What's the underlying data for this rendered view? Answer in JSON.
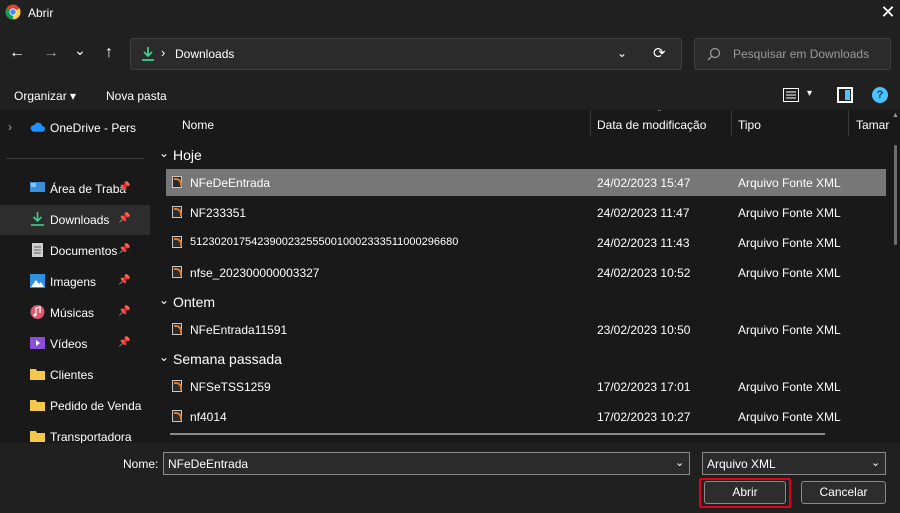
{
  "window": {
    "title": "Abrir",
    "close_glyph": "✕"
  },
  "nav": {
    "back_glyph": "←",
    "forward_glyph": "→",
    "recent_glyph": "⌄",
    "up_glyph": "↑",
    "address": "Downloads",
    "address_chevron": "›",
    "address_dropdown": "⌄",
    "refresh_glyph": "⟳",
    "search_placeholder": "Pesquisar em Downloads"
  },
  "toolbar": {
    "organize": "Organizar ▾",
    "new_folder": "Nova pasta",
    "view_dropdown": "▾",
    "help": "?"
  },
  "sidebar": {
    "onedrive": {
      "label": "OneDrive - Pers",
      "chevron": "›"
    },
    "items": [
      {
        "label": "Área de Traba",
        "icon": "desktop-icon",
        "pin": "📌"
      },
      {
        "label": "Downloads",
        "icon": "download-icon",
        "pin": "📌"
      },
      {
        "label": "Documentos",
        "icon": "documents-icon",
        "pin": "📌"
      },
      {
        "label": "Imagens",
        "icon": "pictures-icon",
        "pin": "📌"
      },
      {
        "label": "Músicas",
        "icon": "music-icon",
        "pin": "📌"
      },
      {
        "label": "Vídeos",
        "icon": "videos-icon",
        "pin": "📌"
      },
      {
        "label": "Clientes",
        "icon": "folder-icon",
        "pin": ""
      },
      {
        "label": "Pedido de Venda",
        "icon": "folder-icon",
        "pin": ""
      },
      {
        "label": "Transportadora",
        "icon": "folder-icon",
        "pin": ""
      }
    ]
  },
  "columns": {
    "name": "Nome",
    "date": "Data de modificação",
    "type": "Tipo",
    "size": "Tamar"
  },
  "groups": [
    {
      "label": "Hoje",
      "files": [
        {
          "name": "NFeDeEntrada",
          "date": "24/02/2023 15:47",
          "type": "Arquivo Fonte XML"
        },
        {
          "name": "NF233351",
          "date": "24/02/2023 11:47",
          "type": "Arquivo Fonte XML"
        },
        {
          "name": "51230201754239002325550010002333511000296680",
          "date": "24/02/2023 11:43",
          "type": "Arquivo Fonte XML"
        },
        {
          "name": "nfse_202300000003327",
          "date": "24/02/2023 10:52",
          "type": "Arquivo Fonte XML"
        }
      ]
    },
    {
      "label": "Ontem",
      "files": [
        {
          "name": "NFeEntrada11591",
          "date": "23/02/2023 10:50",
          "type": "Arquivo Fonte XML"
        }
      ]
    },
    {
      "label": "Semana passada",
      "files": [
        {
          "name": "NFSeTSS1259",
          "date": "17/02/2023 17:01",
          "type": "Arquivo Fonte XML"
        },
        {
          "name": "nf4014",
          "date": "17/02/2023 10:27",
          "type": "Arquivo Fonte XML"
        }
      ]
    }
  ],
  "footer": {
    "name_label": "Nome:",
    "name_value": "NFeDeEntrada",
    "dropdown_glyph": "⌄",
    "file_type": "Arquivo XML",
    "open_label": "Abrir",
    "cancel_label": "Cancelar"
  },
  "colors": {
    "accent": "#4cc2ff",
    "highlight": "#e0001b",
    "selection": "#777777"
  }
}
